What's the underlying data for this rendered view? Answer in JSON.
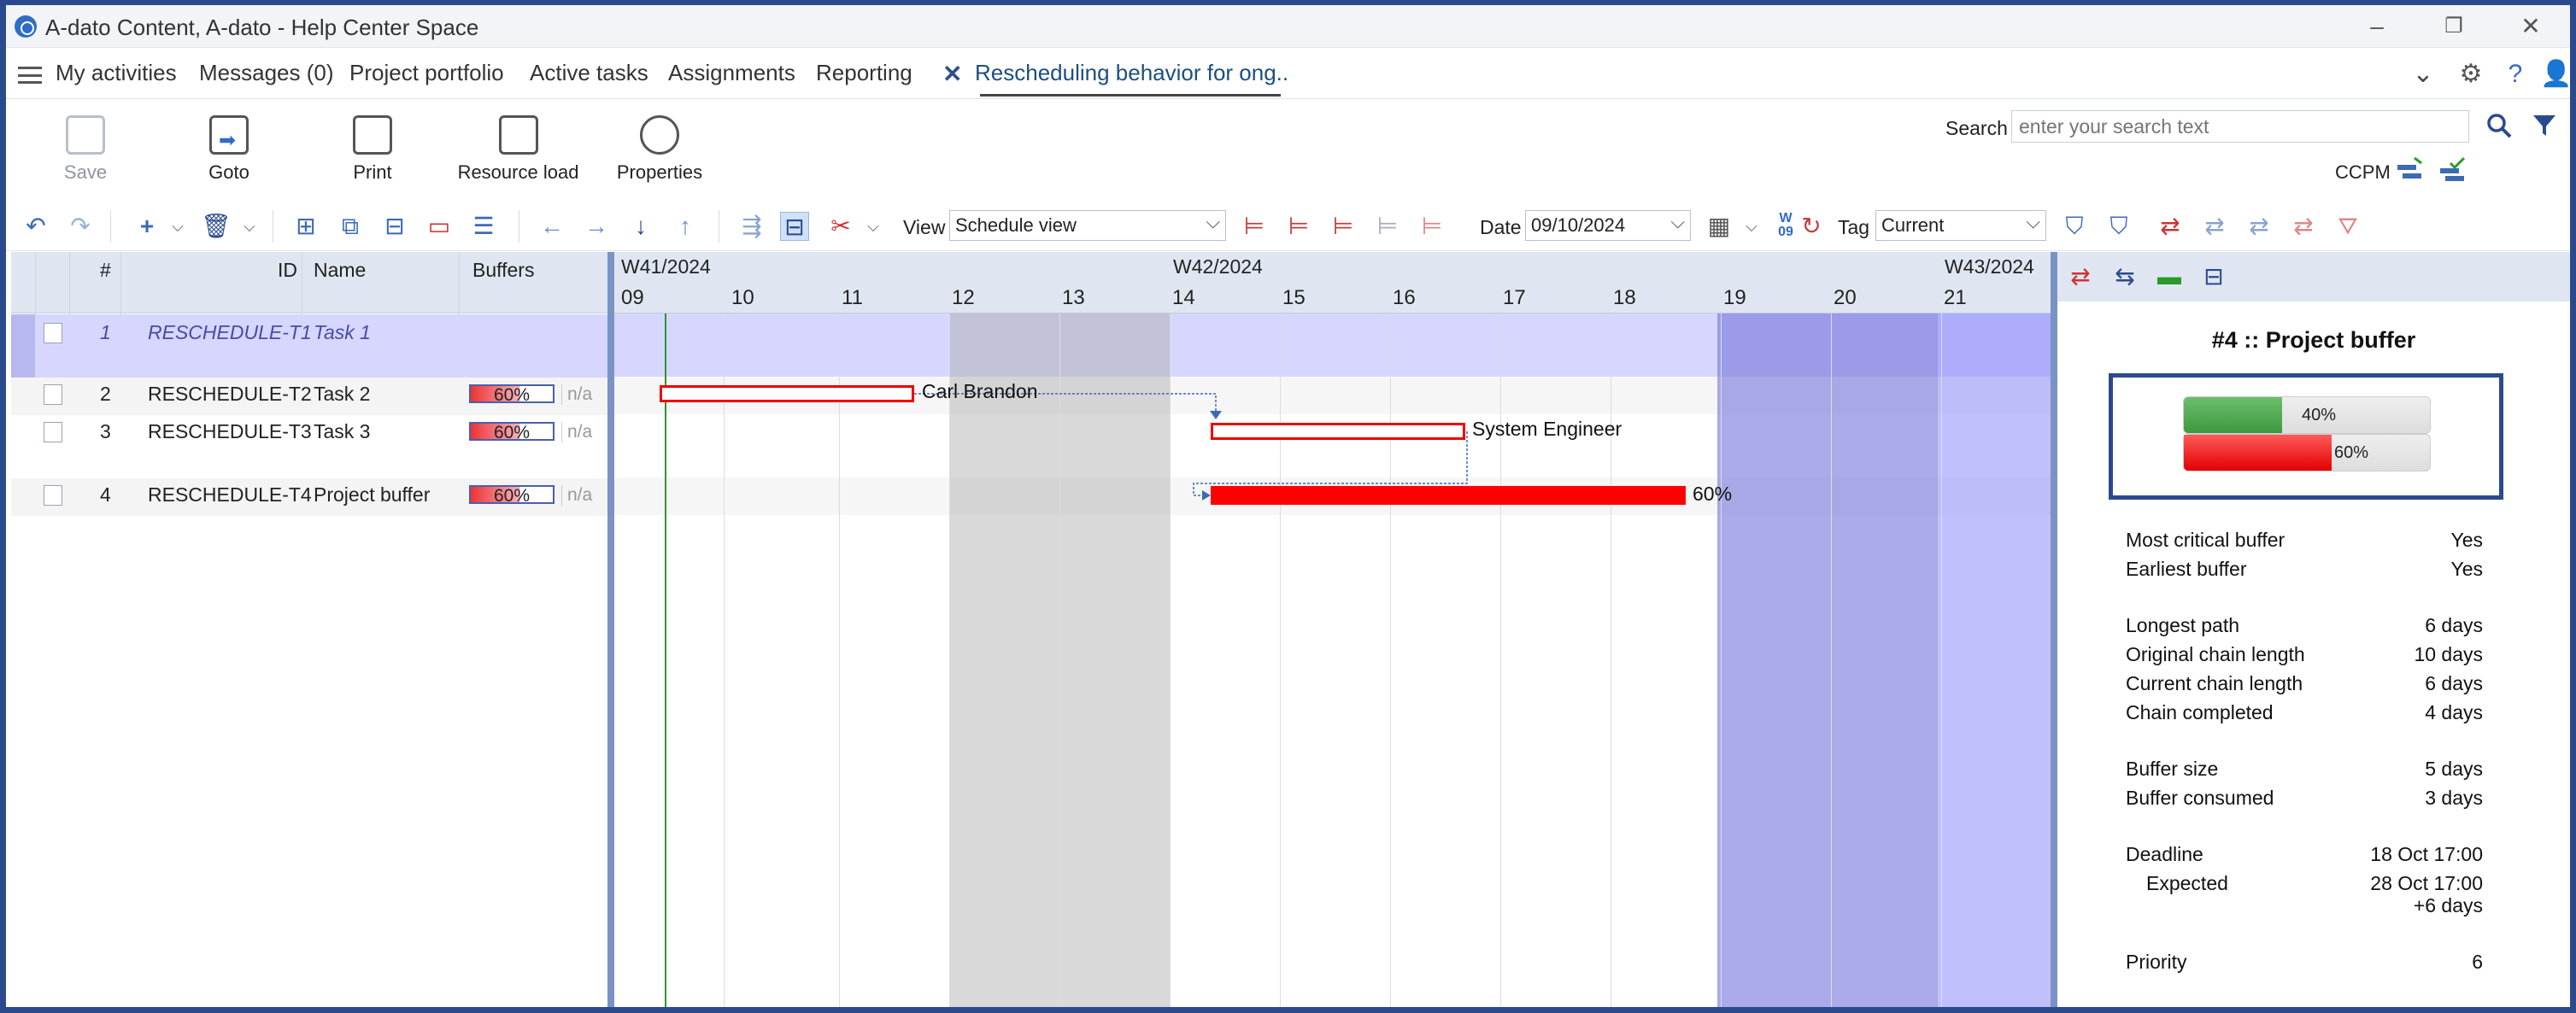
{
  "window": {
    "title": "A-dato Content, A-dato - Help Center Space"
  },
  "nav": {
    "items": [
      {
        "label": "My activities"
      },
      {
        "label": "Messages (0)"
      },
      {
        "label": "Project portfolio"
      },
      {
        "label": "Active tasks"
      },
      {
        "label": "Assignments"
      },
      {
        "label": "Reporting"
      }
    ],
    "active_tab": "Rescheduling behavior for ong.."
  },
  "ribbon": {
    "save": "Save",
    "goto": "Goto",
    "print": "Print",
    "resource_load": "Resource load",
    "properties": "Properties",
    "search_label": "Search",
    "search_placeholder": "enter your search text",
    "ccpm": "CCPM"
  },
  "toolbar": {
    "view_label": "View",
    "view_value": "Schedule view",
    "date_label": "Date",
    "date_value": "09/10/2024",
    "tag_label": "Tag",
    "tag_value": "Current"
  },
  "grid": {
    "headers": {
      "num": "#",
      "id": "ID",
      "name": "Name",
      "buffers": "Buffers"
    },
    "rows": [
      {
        "num": "1",
        "id": "RESCHEDULE-T1",
        "name": "Task 1",
        "buffer": ""
      },
      {
        "num": "2",
        "id": "RESCHEDULE-T2",
        "name": "Task 2",
        "buffer": "60%",
        "na": "n/a"
      },
      {
        "num": "3",
        "id": "RESCHEDULE-T3",
        "name": "Task 3",
        "buffer": "60%",
        "na": "n/a"
      },
      {
        "num": "4",
        "id": "RESCHEDULE-T4",
        "name": "Project buffer",
        "buffer": "60%",
        "na": "n/a"
      }
    ]
  },
  "gantt": {
    "weeks": [
      "W41/2024",
      "W42/2024",
      "W43/2024"
    ],
    "days": [
      "09",
      "10",
      "11",
      "12",
      "13",
      "14",
      "15",
      "16",
      "17",
      "18",
      "19",
      "20",
      "21"
    ],
    "labels": {
      "task2": "Carl Brandon",
      "task3": "System Engineer",
      "buffer": "60%"
    }
  },
  "panel": {
    "title": "#4 :: Project buffer",
    "gauge": {
      "chain_completed": "40%",
      "buffer_consumed": "60%",
      "chain_completed_value": 0.4,
      "buffer_consumed_value": 0.6
    },
    "props": {
      "most_critical_label": "Most critical buffer",
      "most_critical": "Yes",
      "earliest_label": "Earliest buffer",
      "earliest": "Yes",
      "longest_label": "Longest path",
      "longest": "6 days",
      "orig_label": "Original chain length",
      "orig": "10 days",
      "current_label": "Current chain length",
      "current": "6 days",
      "completed_label": "Chain completed",
      "completed": "4 days",
      "size_label": "Buffer size",
      "size": "5 days",
      "consumed_label": "Buffer consumed",
      "consumed": "3 days",
      "deadline_label": "Deadline",
      "deadline": "18 Oct 17:00",
      "expected_label": "Expected",
      "expected": "28 Oct 17:00",
      "expected_delta": "+6 days",
      "priority_label": "Priority",
      "priority": "6"
    }
  },
  "colors": {
    "accent": "#2b4a8e",
    "bar_red": "#ff0000",
    "weekend_band": "#a8a8e8"
  }
}
